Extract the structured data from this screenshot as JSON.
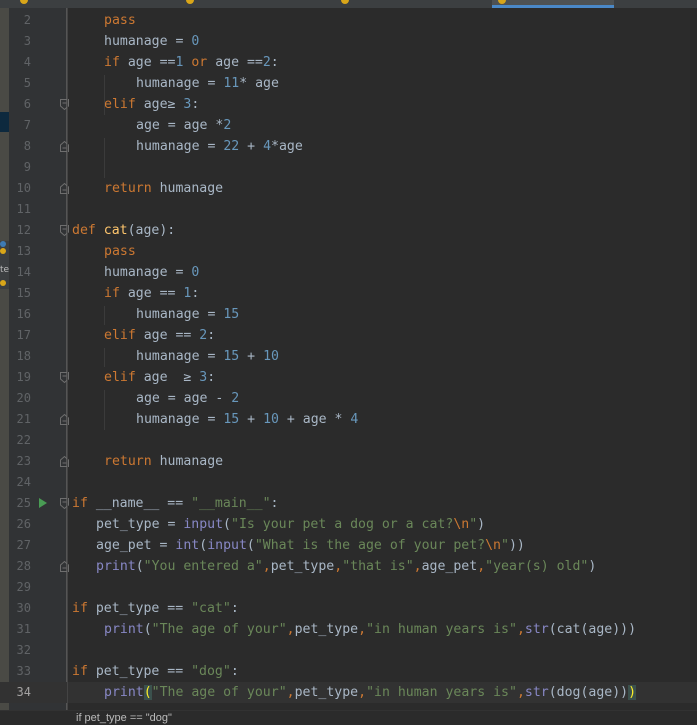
{
  "tabs": [
    {
      "label": "",
      "active": false
    },
    {
      "label": "",
      "active": false
    },
    {
      "label": "",
      "active": false
    },
    {
      "label": "",
      "active": true
    }
  ],
  "side_panel": {
    "label": "te"
  },
  "colors": {
    "background": "#2b2b2b",
    "keyword": "#cc7832",
    "number": "#6897bb",
    "string": "#6a8759",
    "builtin": "#8888c6",
    "function_def": "#ffc66d",
    "identifier": "#a9b7c6",
    "active_tab_underline": "#4a88c7"
  },
  "editor": {
    "current_line": 34,
    "lines": [
      {
        "n": 2,
        "indent": 1,
        "tokens": [
          [
            "kw",
            "pass"
          ]
        ]
      },
      {
        "n": 3,
        "indent": 1,
        "tokens": [
          [
            "id",
            "humanage = "
          ],
          [
            "num",
            "0"
          ]
        ]
      },
      {
        "n": 4,
        "indent": 1,
        "tokens": [
          [
            "kw",
            "if"
          ],
          [
            "id",
            " age =="
          ],
          [
            "num",
            "1"
          ],
          [
            "kw",
            " or"
          ],
          [
            "id",
            " age =="
          ],
          [
            "num",
            "2"
          ],
          [
            "id",
            ":"
          ]
        ]
      },
      {
        "n": 5,
        "indent": 2,
        "tokens": [
          [
            "id",
            "humanage = "
          ],
          [
            "num",
            "11"
          ],
          [
            "id",
            "* age"
          ]
        ]
      },
      {
        "n": 6,
        "indent": 1,
        "tokens": [
          [
            "kw",
            "elif"
          ],
          [
            "id",
            " age≥ "
          ],
          [
            "num",
            "3"
          ],
          [
            "id",
            ":"
          ]
        ]
      },
      {
        "n": 7,
        "indent": 2,
        "tokens": [
          [
            "id",
            "age = age *"
          ],
          [
            "num",
            "2"
          ]
        ]
      },
      {
        "n": 8,
        "indent": 2,
        "tokens": [
          [
            "id",
            "humanage = "
          ],
          [
            "num",
            "22"
          ],
          [
            "id",
            " + "
          ],
          [
            "num",
            "4"
          ],
          [
            "id",
            "*age"
          ]
        ]
      },
      {
        "n": 9,
        "indent": 0,
        "tokens": []
      },
      {
        "n": 10,
        "indent": 1,
        "tokens": [
          [
            "kw",
            "return"
          ],
          [
            "id",
            " humanage"
          ]
        ]
      },
      {
        "n": 11,
        "indent": 0,
        "tokens": []
      },
      {
        "n": 12,
        "indent": 0,
        "tokens": [
          [
            "kw",
            "def "
          ],
          [
            "fn",
            "cat"
          ],
          [
            "id",
            "(age):"
          ]
        ]
      },
      {
        "n": 13,
        "indent": 1,
        "tokens": [
          [
            "kw",
            "pass"
          ]
        ]
      },
      {
        "n": 14,
        "indent": 1,
        "tokens": [
          [
            "id",
            "humanage = "
          ],
          [
            "num",
            "0"
          ]
        ]
      },
      {
        "n": 15,
        "indent": 1,
        "tokens": [
          [
            "kw",
            "if"
          ],
          [
            "id",
            " age == "
          ],
          [
            "num",
            "1"
          ],
          [
            "id",
            ":"
          ]
        ]
      },
      {
        "n": 16,
        "indent": 2,
        "tokens": [
          [
            "id",
            "humanage = "
          ],
          [
            "num",
            "15"
          ]
        ]
      },
      {
        "n": 17,
        "indent": 1,
        "tokens": [
          [
            "kw",
            "elif"
          ],
          [
            "id",
            " age == "
          ],
          [
            "num",
            "2"
          ],
          [
            "id",
            ":"
          ]
        ]
      },
      {
        "n": 18,
        "indent": 2,
        "tokens": [
          [
            "id",
            "humanage = "
          ],
          [
            "num",
            "15"
          ],
          [
            "id",
            " + "
          ],
          [
            "num",
            "10"
          ]
        ]
      },
      {
        "n": 19,
        "indent": 1,
        "tokens": [
          [
            "kw",
            "elif"
          ],
          [
            "id",
            " age  ≥ "
          ],
          [
            "num",
            "3"
          ],
          [
            "id",
            ":"
          ]
        ]
      },
      {
        "n": 20,
        "indent": 2,
        "tokens": [
          [
            "id",
            "age = age - "
          ],
          [
            "num",
            "2"
          ]
        ]
      },
      {
        "n": 21,
        "indent": 2,
        "tokens": [
          [
            "id",
            "humanage = "
          ],
          [
            "num",
            "15"
          ],
          [
            "id",
            " + "
          ],
          [
            "num",
            "10"
          ],
          [
            "id",
            " + age * "
          ],
          [
            "num",
            "4"
          ]
        ]
      },
      {
        "n": 22,
        "indent": 0,
        "tokens": []
      },
      {
        "n": 23,
        "indent": 1,
        "tokens": [
          [
            "kw",
            "return"
          ],
          [
            "id",
            " humanage"
          ]
        ]
      },
      {
        "n": 24,
        "indent": 0,
        "tokens": []
      },
      {
        "n": 25,
        "indent": 0,
        "tokens": [
          [
            "kw",
            "if"
          ],
          [
            "id",
            " __name__ == "
          ],
          [
            "str",
            "\"__main__\""
          ],
          [
            "id",
            ":"
          ]
        ]
      },
      {
        "n": 26,
        "indent": 0.75,
        "tokens": [
          [
            "id",
            "pet_type = "
          ],
          [
            "bi",
            "input"
          ],
          [
            "id",
            "("
          ],
          [
            "str",
            "\"Is your pet a dog or a cat?"
          ],
          [
            "esc",
            "\\n"
          ],
          [
            "str",
            "\""
          ],
          [
            "id",
            ")"
          ]
        ]
      },
      {
        "n": 27,
        "indent": 0.75,
        "tokens": [
          [
            "id",
            "age_pet = "
          ],
          [
            "bi",
            "int"
          ],
          [
            "id",
            "("
          ],
          [
            "bi",
            "input"
          ],
          [
            "id",
            "("
          ],
          [
            "str",
            "\"What is the age of your pet?"
          ],
          [
            "esc",
            "\\n"
          ],
          [
            "str",
            "\""
          ],
          [
            "id",
            "))"
          ]
        ]
      },
      {
        "n": 28,
        "indent": 0.75,
        "tokens": [
          [
            "bi",
            "print"
          ],
          [
            "id",
            "("
          ],
          [
            "str",
            "\"You entered a\""
          ],
          [
            "kw",
            ","
          ],
          [
            "id",
            "pet_type"
          ],
          [
            "kw",
            ","
          ],
          [
            "str",
            "\"that is\""
          ],
          [
            "kw",
            ","
          ],
          [
            "id",
            "age_pet"
          ],
          [
            "kw",
            ","
          ],
          [
            "str",
            "\"year(s) old\""
          ],
          [
            "id",
            ")"
          ]
        ]
      },
      {
        "n": 29,
        "indent": 0,
        "tokens": []
      },
      {
        "n": 30,
        "indent": 0,
        "tokens": [
          [
            "kw",
            "if"
          ],
          [
            "id",
            " pet_type == "
          ],
          [
            "str",
            "\"cat\""
          ],
          [
            "id",
            ":"
          ]
        ]
      },
      {
        "n": 31,
        "indent": 1,
        "tokens": [
          [
            "bi",
            "print"
          ],
          [
            "id",
            "("
          ],
          [
            "str",
            "\"The age of your\""
          ],
          [
            "kw",
            ","
          ],
          [
            "id",
            "pet_type"
          ],
          [
            "kw",
            ","
          ],
          [
            "str",
            "\"in human years is\""
          ],
          [
            "kw",
            ","
          ],
          [
            "bi",
            "str"
          ],
          [
            "id",
            "(cat(age)))"
          ]
        ]
      },
      {
        "n": 32,
        "indent": 0,
        "tokens": []
      },
      {
        "n": 33,
        "indent": 0,
        "tokens": [
          [
            "kw",
            "if"
          ],
          [
            "id",
            " pet_type == "
          ],
          [
            "str",
            "\"dog\""
          ],
          [
            "id",
            ":"
          ]
        ]
      },
      {
        "n": 34,
        "indent": 1,
        "tokens": [
          [
            "bi",
            "print"
          ],
          [
            "hl",
            "("
          ],
          [
            "str",
            "\"The age of your\""
          ],
          [
            "kw",
            ","
          ],
          [
            "id",
            "pet_type"
          ],
          [
            "kw",
            ","
          ],
          [
            "str",
            "\"in human years is\""
          ],
          [
            "kw",
            ","
          ],
          [
            "bi",
            "str"
          ],
          [
            "id",
            "(dog(age))"
          ],
          [
            "hl",
            ")"
          ]
        ]
      }
    ]
  },
  "breadcrumb": {
    "text": "if pet_type == \"dog\""
  }
}
